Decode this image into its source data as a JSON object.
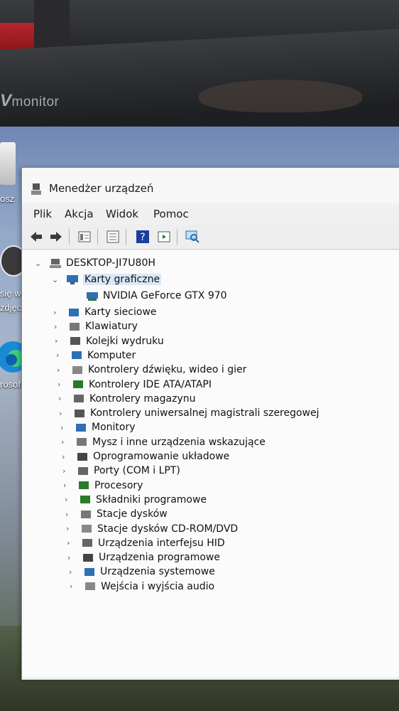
{
  "monitor": {
    "brand_prefix": "V",
    "brand_suffix": "monitor"
  },
  "desktop": {
    "labels": [
      "osz",
      "się wi",
      "zdjęci",
      "rosoft E"
    ]
  },
  "window": {
    "title": "Menedżer urządzeń",
    "menu": [
      "Plik",
      "Akcja",
      "Widok",
      "Pomoc"
    ],
    "toolbar_icons": [
      "back-arrow-icon",
      "forward-arrow-icon",
      "properties-view-icon",
      "list-view-icon",
      "help-icon",
      "action-icon",
      "scan-hardware-icon"
    ],
    "root": "DESKTOP-JI7U80H",
    "expanded_category": "Karty graficzne",
    "expanded_device": "NVIDIA GeForce GTX 970",
    "categories": [
      "Karty sieciowe",
      "Klawiatury",
      "Kolejki wydruku",
      "Komputer",
      "Kontrolery dźwięku, wideo i gier",
      "Kontrolery IDE ATA/ATAPI",
      "Kontrolery magazynu",
      "Kontrolery uniwersalnej magistrali szeregowej",
      "Monitory",
      "Mysz i inne urządzenia wskazujące",
      "Oprogramowanie układowe",
      "Porty (COM i LPT)",
      "Procesory",
      "Składniki programowe",
      "Stacje dysków",
      "Stacje dysków CD-ROM/DVD",
      "Urządzenia interfejsu HID",
      "Urządzenia programowe",
      "Urządzenia systemowe",
      "Wejścia i wyjścia audio"
    ]
  }
}
